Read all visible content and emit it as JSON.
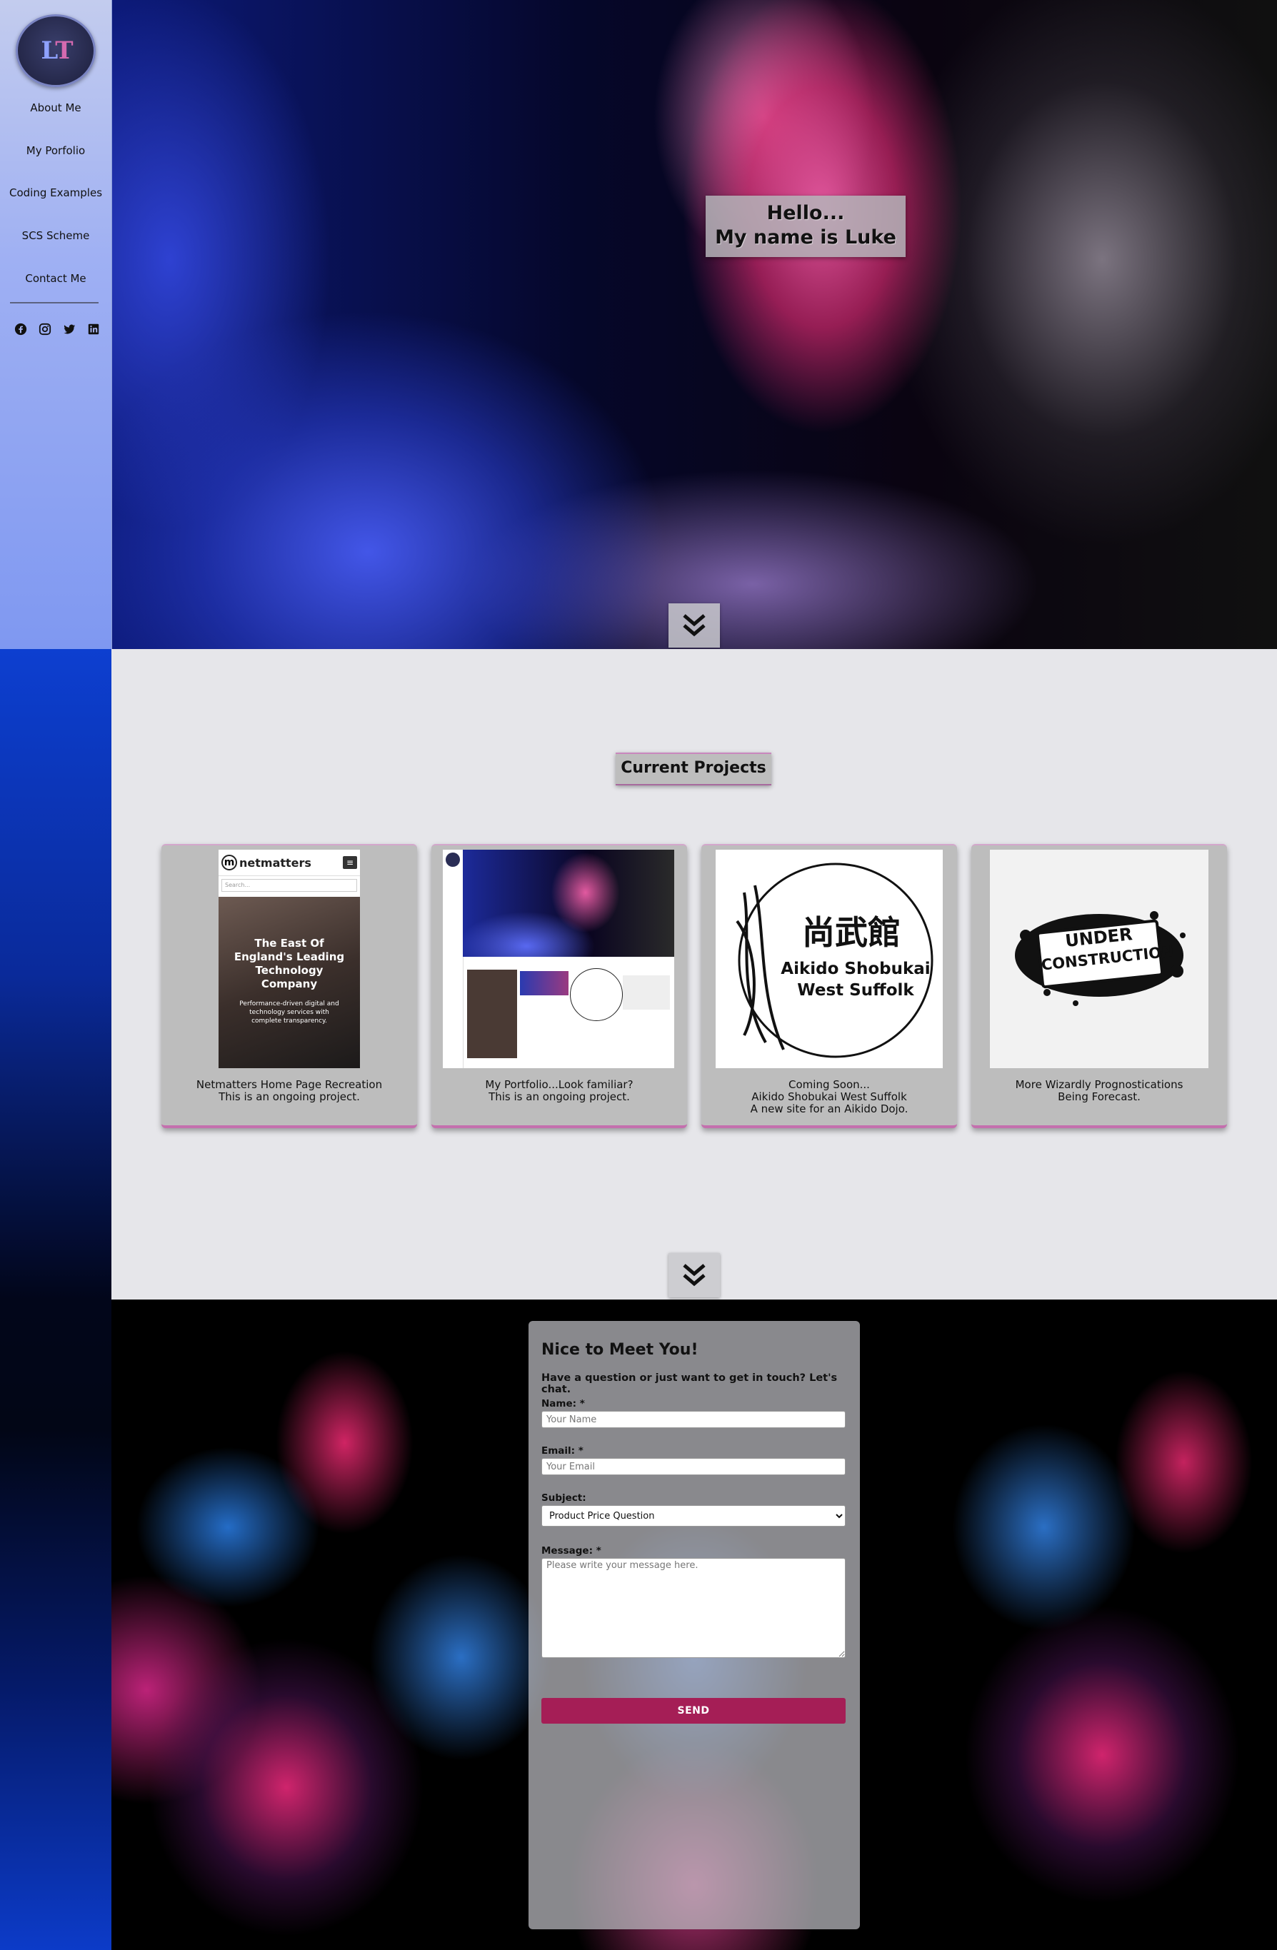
{
  "sidebar": {
    "logo_text_a": "L",
    "logo_text_b": "T",
    "nav": [
      {
        "label": "About Me"
      },
      {
        "label": "My Porfolio"
      },
      {
        "label": "Coding Examples"
      },
      {
        "label": "SCS Scheme"
      },
      {
        "label": "Contact Me"
      }
    ],
    "social": [
      "facebook-icon",
      "instagram-icon",
      "twitter-icon",
      "linkedin-icon"
    ]
  },
  "hero": {
    "line1": "Hello...",
    "line2": "My name is Luke"
  },
  "projects": {
    "title": "Current Projects",
    "cards": [
      {
        "line1": "Netmatters Home Page Recreation",
        "line2": "This is an ongoing project.",
        "line3": ""
      },
      {
        "line1": "My Portfolio...Look familiar?",
        "line2": "This is an ongoing project.",
        "line3": ""
      },
      {
        "line1": "Coming Soon...",
        "line2": "Aikido Shobukai West Suffolk",
        "line3": "A new site for an Aikido Dojo."
      },
      {
        "line1": "More Wizardly Prognostications",
        "line2": "Being Forecast.",
        "line3": ""
      }
    ],
    "netmatters_thumb": {
      "brand": "netmatters",
      "search_placeholder": "Search...",
      "headline": "The East Of England's Leading Technology Company",
      "sub": "Performance-driven digital and technology services with complete transparency."
    },
    "aikido_thumb": {
      "kanji": "尚武館",
      "name1": "Aikido Shobukai",
      "name2": "West Suffolk"
    },
    "construction_thumb": {
      "line1": "UNDER",
      "line2": "CONSTRUCTION"
    }
  },
  "contact": {
    "title": "Nice to Meet You!",
    "intro": "Have a question or just want to get in touch? Let's chat.",
    "name_label": "Name: *",
    "name_placeholder": "Your Name",
    "email_label": "Email: *",
    "email_placeholder": "Your Email",
    "subject_label": "Subject:",
    "subject_value": "Product Price Question",
    "message_label": "Message: *",
    "message_placeholder": "Please write your message here.",
    "send_label": "SEND"
  },
  "colors": {
    "accent": "#a51e56",
    "card_border": "#c46fae",
    "projects_bg": "#e6e6ea"
  }
}
